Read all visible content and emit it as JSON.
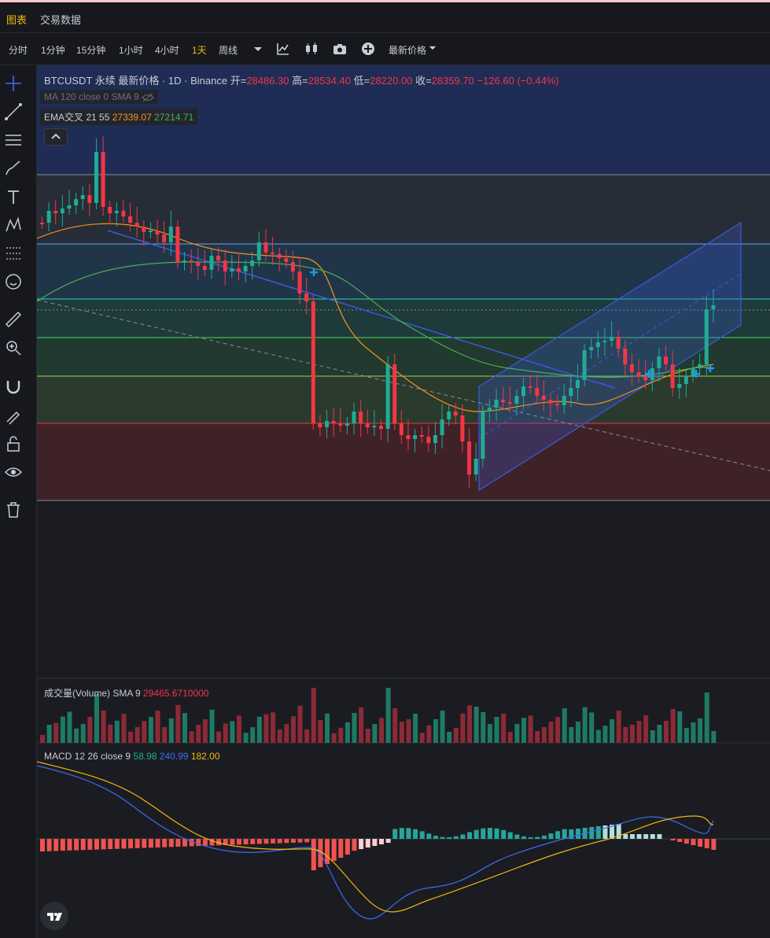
{
  "tabs": [
    {
      "label": "图表",
      "active": true
    },
    {
      "label": "交易数据",
      "active": false
    }
  ],
  "toolbar": {
    "intervals": [
      "分时",
      "1分钟",
      "15分钟",
      "1小时",
      "4小时",
      "1天",
      "周线"
    ],
    "active_interval": "1天",
    "price_type": "最新价格",
    "icons": [
      "chevron-down-icon",
      "indicators-icon",
      "candle-type-icon",
      "camera-icon",
      "plus-circle-icon"
    ]
  },
  "sidebar_icons": [
    "crosshair-icon",
    "trendline-icon",
    "horizontal-lines-icon",
    "brush-icon",
    "text-icon",
    "pattern-icon",
    "fib-icon",
    "emoji-icon",
    "ruler-icon",
    "zoom-icon",
    "magnet-icon",
    "lock-draw-icon",
    "lock-icon",
    "eye-icon",
    "trash-icon"
  ],
  "main_legend": {
    "symbol": "BTCUSDT 永续 最新价格 · 1D · Binance",
    "open_label": "开=",
    "open": "28486.30",
    "high_label": "高=",
    "high": "28534.40",
    "low_label": "低=",
    "low": "28220.00",
    "close_label": "收=",
    "close": "28359.70",
    "change": "−126.60 (−0.44%)"
  },
  "ma_legend": "MA 120 close 0 SMA 9",
  "ema_legend": {
    "name": "EMA交叉 21 55",
    "v1": "27339.07",
    "v2": "27214.71"
  },
  "volume_legend": {
    "name": "成交量(Volume) SMA 9",
    "value": "29465.6710000"
  },
  "macd_legend": {
    "name": "MACD 12 26 close 9",
    "hist": "58.98",
    "macd": "240.99",
    "signal": "182.00"
  },
  "colors": {
    "up": "#22ab94",
    "down": "#f23645",
    "ema_fast": "#f7931a",
    "ema_slow": "#4caf50",
    "macd": "#3c6df0",
    "signal": "#f0b90b",
    "channel": "#3a5ad9"
  },
  "chart_data": {
    "type": "candlestick",
    "up_count": 40,
    "down_count": 40
  }
}
